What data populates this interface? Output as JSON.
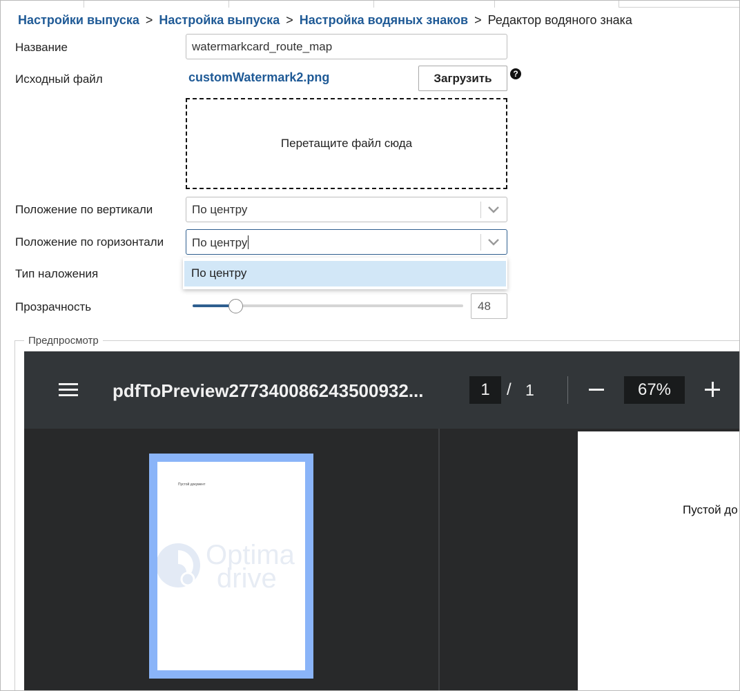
{
  "breadcrumb": {
    "items": [
      "Настройки выпуска",
      "Настройка выпуска",
      "Настройка водяных знаков"
    ],
    "separator": ">",
    "current": "Редактор водяного знака"
  },
  "form": {
    "name_label": "Название",
    "name_value": "watermarkcard_route_map",
    "source_label": "Исходный файл",
    "source_file": "customWatermark2.png",
    "upload_label": "Загрузить",
    "help_icon": "question-circle",
    "dropzone_text": "Перетащите файл сюда",
    "vertical_label": "Положение по вертикали",
    "vertical_value": "По центру",
    "horizontal_label": "Положение по горизонтали",
    "horizontal_value": "По центру",
    "horizontal_options": [
      "По центру"
    ],
    "overlay_label": "Тип наложения",
    "opacity_label": "Прозрачность",
    "opacity_value": "48",
    "opacity_slider_fraction": 0.14
  },
  "preview": {
    "legend": "Предпросмотр",
    "viewer": {
      "title": "pdfToPreview27734008624350093​2...",
      "page_current": "1",
      "page_separator": "/",
      "page_total": "1",
      "zoom": "67%",
      "thumbnail_text": "Пустой документ",
      "page_text": "Пустой до",
      "watermark_logo": {
        "line1": "Optima",
        "line2": "drive"
      }
    }
  },
  "colors": {
    "link": "#1f5a96",
    "viewer_toolbar": "#323639",
    "viewer_bg": "#28292a",
    "thumbnail_highlight": "#8ab4f8",
    "dropdown_highlight": "#d2e7f7"
  }
}
